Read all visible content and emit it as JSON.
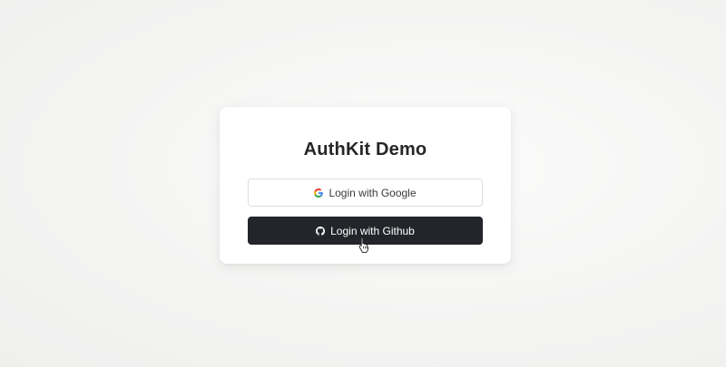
{
  "card": {
    "title": "AuthKit Demo"
  },
  "buttons": {
    "google": {
      "label": "Login with Google",
      "icon": "google-icon"
    },
    "github": {
      "label": "Login with Github",
      "icon": "github-icon"
    }
  },
  "colors": {
    "background": "#f4f4f3",
    "card": "#ffffff",
    "github_button": "#23252a",
    "google_border": "#dddddd",
    "title_text": "#262626"
  }
}
